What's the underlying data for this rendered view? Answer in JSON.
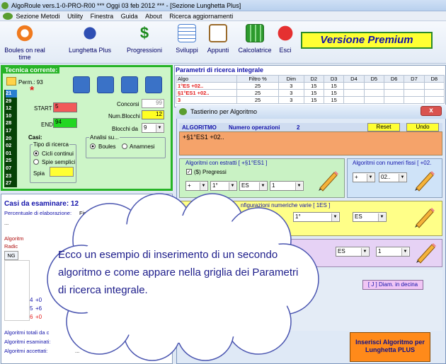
{
  "titlebar": {
    "text": "AlgoRoule vers.1-0-PRO-R00  ***  Oggi 03 feb 2012  ***  - [Sezione Lunghetta Plus]"
  },
  "menu": [
    "Sezione Metodi",
    "Utility",
    "Finestra",
    "Guida",
    "About",
    "Ricerca aggiornamenti"
  ],
  "toolbar": {
    "items": [
      "Boules on real time",
      "Lunghetta Plus",
      "Progressioni",
      "Sviluppi",
      "Appunti",
      "Calcolatrice",
      "Esci"
    ],
    "premium": "Versione Premium"
  },
  "tecnica": {
    "title": "Tecnica corrente:",
    "perm": "Perm.: 93",
    "numbers": [
      "21",
      "29",
      "12",
      "10",
      "28",
      "17",
      "20",
      "02",
      "01",
      "25",
      "07",
      "23",
      "27"
    ],
    "start_label": "START",
    "start_value": "5",
    "end_label": "END",
    "end_value": "94",
    "concorsi_label": "Concorsi",
    "concorsi_value": "99",
    "numblocchi_label": "Num.Blocchi",
    "numblocchi_value": "12",
    "blocchida_label": "Blocchi da",
    "blocchida_value": "9",
    "casi_label": "Casi:",
    "tipo_label": "Tipo di ricerca",
    "cicli": "Cicli continui",
    "spie": "Spie semplici",
    "spia_label": "Spia",
    "analisi_label": "Analisi su...",
    "boules": "Boules",
    "anamnesi": "Anamnesi"
  },
  "casi": {
    "title": "Casi da esaminare: 12",
    "percentuale": "Percentuale di elaborazione:",
    "fine": "Fine",
    "algoritmi": "Algoritm",
    "radice": "Radic",
    "ng": "NG",
    "rows": [
      "4",
      "5",
      "6"
    ],
    "rowvals": [
      "+0",
      "+6",
      "+0"
    ],
    "totali": "Algoritmi totali da c",
    "esaminati": "Algoritmi esaminati:",
    "accettati": "Algoritmi accettati:",
    "dots": "..."
  },
  "grid": {
    "title": "Parametri di ricerca integrale",
    "headers": [
      "Algo",
      "Filtro %",
      "Dim",
      "D2",
      "D3",
      "D4",
      "D5",
      "D6",
      "D7",
      "D8"
    ],
    "rows": [
      [
        "1°ES +02..",
        "25",
        "3",
        "15",
        "15"
      ],
      [
        "§1°ES1 +02..",
        "25",
        "3",
        "15",
        "15"
      ],
      [
        "3",
        "25",
        "3",
        "15",
        "15"
      ]
    ]
  },
  "dialog": {
    "title": "Tastierino per Algoritmo",
    "close": "x",
    "algoritmo": "ALGORITMO",
    "numero_op": "Numero operazioni",
    "num_op_value": "2",
    "reset": "Reset",
    "undo": "Undo",
    "formula": "+§1°ES1 +02..",
    "estratti_title": "Algoritmi con estratti  [ +§1°ES1 ]",
    "pregressi": "($) Pregressi",
    "sel1": "+",
    "sel2": "1°",
    "sel3": "ES",
    "sel4": "1",
    "fissi_title": "Algoritmi con numeri fissi  [ +02.",
    "fsel1": "+",
    "fsel2": "02..",
    "config_title": "nfigurazioni numeriche varie  [ 1ES ]",
    "csel2": "1°",
    "csel3": "ES",
    "rsel1": "ES",
    "rsel2": "1",
    "diam": "[ J ] Diam. in decina",
    "inserisci": "Inserisci Algoritmo per Lunghetta PLUS"
  },
  "cloud": {
    "text": "Ecco un esempio di inserimento di un secondo algoritmo e come appare nella griglia dei Parametri di ricerca integrale."
  },
  "colors": {
    "panel_green": "#cdf5c8",
    "border_green": "#27b427",
    "premium_yellow": "#ffff33",
    "formula_orange": "#f5a36a",
    "insert_orange": "#ff8a1a"
  }
}
